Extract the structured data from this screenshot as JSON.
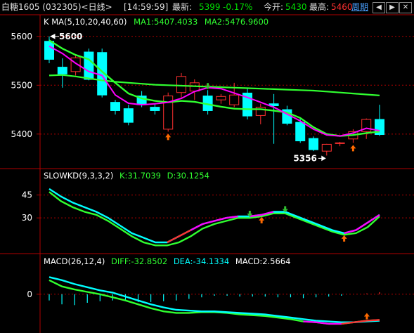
{
  "header": {
    "title": "白糖1605 (032305)<日线>",
    "time": "[14:59:59]",
    "latest_label": "最新:",
    "latest_value": "5399",
    "change": "-0.17%",
    "open_label": "今开:",
    "open_value": "5430",
    "high_label": "最高:",
    "high_value": "5460",
    "period_link": "周期",
    "prev_icon": "◀",
    "next_icon": "▶",
    "close_icon": "✕"
  },
  "colors": {
    "up": "#ff3030",
    "down": "#00ffff",
    "ma5": "#ff00ff",
    "ma10": "#30ff30",
    "axis": "#b00000",
    "label_green": "#00e000",
    "label_cyan": "#00ffff",
    "label_white": "#ffffff",
    "arrow_up": "#ff6a00",
    "arrow_down": "#30c030"
  },
  "chart_data": [
    {
      "type": "candlestick",
      "legend_prefix": "K  MA(5,10,20,40,60)",
      "legend_ma1": "MA1:5407.4033",
      "legend_ma2": "MA2:5476.9600",
      "yticks": [
        "5600",
        "5500",
        "5400"
      ],
      "ylim": [
        5335,
        5640
      ],
      "annotations": {
        "high": "5600",
        "low": "5356"
      },
      "candles": [
        {
          "o": 5590,
          "h": 5600,
          "l": 5545,
          "c": 5553
        },
        {
          "o": 5537,
          "h": 5555,
          "l": 5495,
          "c": 5523
        },
        {
          "o": 5528,
          "h": 5563,
          "l": 5520,
          "c": 5556
        },
        {
          "o": 5568,
          "h": 5575,
          "l": 5510,
          "c": 5512
        },
        {
          "o": 5567,
          "h": 5575,
          "l": 5475,
          "c": 5480
        },
        {
          "o": 5465,
          "h": 5470,
          "l": 5440,
          "c": 5448
        },
        {
          "o": 5452,
          "h": 5460,
          "l": 5418,
          "c": 5424
        },
        {
          "o": 5478,
          "h": 5488,
          "l": 5455,
          "c": 5460
        },
        {
          "o": 5455,
          "h": 5462,
          "l": 5440,
          "c": 5448
        },
        {
          "o": 5410,
          "h": 5485,
          "l": 5405,
          "c": 5478
        },
        {
          "o": 5485,
          "h": 5525,
          "l": 5475,
          "c": 5518
        },
        {
          "o": 5488,
          "h": 5512,
          "l": 5470,
          "c": 5505
        },
        {
          "o": 5478,
          "h": 5490,
          "l": 5440,
          "c": 5448
        },
        {
          "o": 5470,
          "h": 5482,
          "l": 5462,
          "c": 5477
        },
        {
          "o": 5460,
          "h": 5505,
          "l": 5455,
          "c": 5480
        },
        {
          "o": 5484,
          "h": 5495,
          "l": 5430,
          "c": 5437
        },
        {
          "o": 5438,
          "h": 5462,
          "l": 5420,
          "c": 5455
        },
        {
          "o": 5462,
          "h": 5482,
          "l": 5380,
          "c": 5458
        },
        {
          "o": 5450,
          "h": 5458,
          "l": 5418,
          "c": 5422
        },
        {
          "o": 5424,
          "h": 5434,
          "l": 5382,
          "c": 5386
        },
        {
          "o": 5391,
          "h": 5395,
          "l": 5365,
          "c": 5368
        },
        {
          "o": 5365,
          "h": 5380,
          "l": 5356,
          "c": 5379
        },
        {
          "o": 5382,
          "h": 5384,
          "l": 5375,
          "c": 5382
        },
        {
          "o": 5390,
          "h": 5410,
          "l": 5382,
          "c": 5405
        },
        {
          "o": 5405,
          "h": 5432,
          "l": 5390,
          "c": 5430
        },
        {
          "o": 5430,
          "h": 5460,
          "l": 5396,
          "c": 5399
        }
      ],
      "ma5": [
        5580,
        5565,
        5545,
        5528,
        5520,
        5480,
        5463,
        5460,
        5462,
        5465,
        5473,
        5487,
        5495,
        5493,
        5484,
        5475,
        5465,
        5455,
        5441,
        5427,
        5410,
        5398,
        5396,
        5402,
        5412,
        5407
      ],
      "ma10": [
        5592,
        5575,
        5562,
        5553,
        5528,
        5505,
        5483,
        5473,
        5468,
        5465,
        5468,
        5466,
        5461,
        5456,
        5452,
        5451,
        5451,
        5448,
        5444,
        5433,
        5414,
        5400,
        5396,
        5398,
        5402,
        5405
      ],
      "ma_long": [
        5520,
        5521,
        5518,
        5514,
        5510,
        5507,
        5505,
        5503,
        5501,
        5500,
        5499,
        5498,
        5497,
        5496,
        5495,
        5494,
        5493,
        5492,
        5491,
        5490,
        5489,
        5487,
        5485,
        5483,
        5481,
        5479
      ],
      "signals": [
        {
          "i": 9,
          "dir": "up"
        },
        {
          "i": 12,
          "dir": "down"
        },
        {
          "i": 23,
          "dir": "up"
        }
      ]
    },
    {
      "type": "line",
      "legend_prefix": "SLOWKD(9,3,3,2)",
      "legend_k": "K:31.7039",
      "legend_d": "D:30.1254",
      "yticks": [
        "45",
        "30"
      ],
      "ylim": [
        8,
        54
      ],
      "k": [
        49,
        44,
        40,
        37,
        34,
        30,
        25,
        20,
        17,
        14,
        14,
        18,
        22,
        26,
        28,
        30,
        31,
        31,
        32,
        34,
        34,
        31,
        28,
        25,
        22,
        20,
        22,
        27,
        32
      ],
      "d": [
        47,
        41,
        37,
        34,
        32,
        28,
        23,
        18,
        14,
        12,
        12,
        14,
        18,
        23,
        26,
        28,
        30,
        30,
        31,
        33,
        33,
        30,
        27,
        24,
        21,
        19,
        20,
        24,
        31
      ],
      "signals": [
        {
          "i": 17,
          "dir": "down"
        },
        {
          "i": 18,
          "dir": "up"
        },
        {
          "i": 20,
          "dir": "down"
        },
        {
          "i": 25,
          "dir": "up"
        }
      ]
    },
    {
      "type": "line",
      "legend_prefix": "MACD(26,12,4)",
      "legend_diff": "DIFF:-32.8502",
      "legend_dea": "DEA:-34.1334",
      "legend_macd": "MACD:2.5664",
      "yticks": [
        "0"
      ],
      "ylim": [
        -48,
        35
      ],
      "diff": [
        18,
        10,
        6,
        3,
        0,
        -4,
        -8,
        -13,
        -18,
        -22,
        -24,
        -24,
        -23,
        -23,
        -24,
        -26,
        -27,
        -28,
        -30,
        -32,
        -35,
        -36,
        -38,
        -38,
        -36,
        -34,
        -33
      ],
      "dea": [
        22,
        18,
        13,
        9,
        5,
        2,
        -3,
        -8,
        -13,
        -17,
        -20,
        -21,
        -22,
        -22,
        -23,
        -24,
        -25,
        -26,
        -28,
        -30,
        -32,
        -34,
        -35,
        -36,
        -36,
        -35,
        -34
      ],
      "macd": [
        -8,
        -13,
        -14,
        -11,
        -9,
        -8,
        -9,
        -10,
        -10,
        -9,
        -8,
        -6,
        -4,
        -2,
        -2,
        -3,
        -3,
        -3,
        -4,
        -4,
        -5,
        -4,
        -3,
        -2,
        0,
        1,
        2.6
      ],
      "signals": [
        {
          "i": 25,
          "dir": "up"
        }
      ]
    }
  ]
}
